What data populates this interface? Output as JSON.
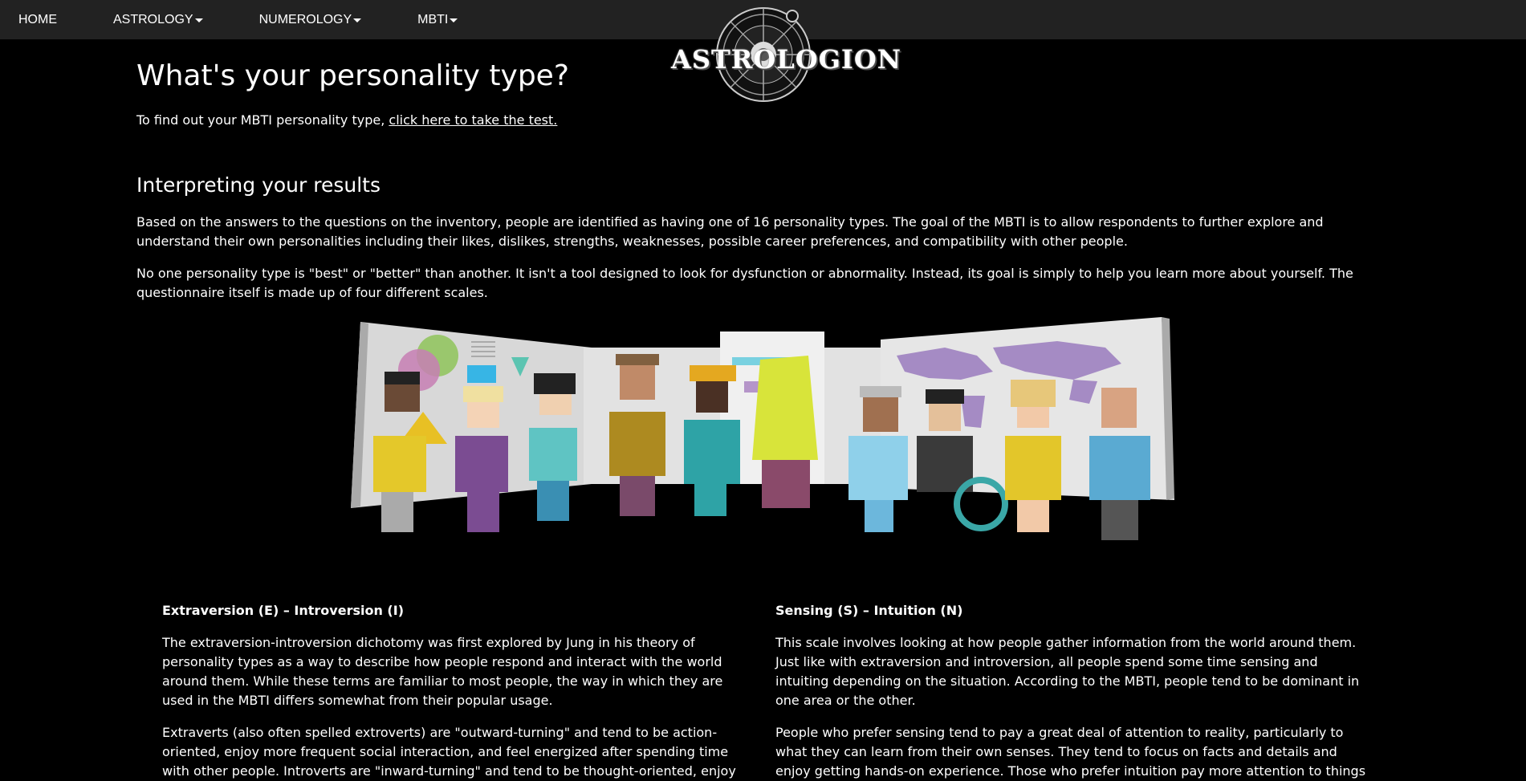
{
  "nav": {
    "home": "HOME",
    "astrology": "ASTROLOGY",
    "numerology": "NUMEROLOGY",
    "mbti": "MBTI"
  },
  "logo": {
    "text": "ASTROLOGION"
  },
  "page": {
    "title": "What's your personality type?",
    "intro_prefix": "To find out your MBTI personality type, ",
    "intro_link": "click here to take the test.",
    "section_heading": "Interpreting your results",
    "para1": "Based on the answers to the questions on the inventory, people are identified as having one of 16 personality types. The goal of the MBTI is to allow respondents to further explore and understand their own personalities including their likes, dislikes, strengths, weaknesses, possible career preferences, and compatibility with other people.",
    "para2": "No one personality type is \"best\" or \"better\" than another. It isn't a tool designed to look for dysfunction or abnormality. Instead, its goal is simply to help you learn more about yourself. The questionnaire itself is made up of four different scales."
  },
  "columns": {
    "left": {
      "heading": "Extraversion (E) – Introversion (I)",
      "p1": "The extraversion-introversion dichotomy was first explored by Jung in his theory of personality types as a way to describe how people respond and interact with the world around them. While these terms are familiar to most people, the way in which they are used in the MBTI differs somewhat from their popular usage.",
      "p2": "Extraverts (also often spelled extroverts) are \"outward-turning\" and tend to be action-oriented, enjoy more frequent social interaction, and feel energized after spending time with other people. Introverts are \"inward-turning\" and tend to be thought-oriented, enjoy deep"
    },
    "right": {
      "heading": "Sensing (S) – Intuition (N)",
      "p1": "This scale involves looking at how people gather information from the world around them. Just like with extraversion and introversion, all people spend some time sensing and intuiting depending on the situation. According to the MBTI, people tend to be dominant in one area or the other.",
      "p2": "People who prefer sensing tend to pay a great deal of attention to reality, particularly to what they can learn from their own senses. They tend to focus on facts and details and enjoy getting hands-on experience. Those who prefer intuition pay more attention to things like"
    }
  },
  "colors": {
    "navbar": "#222222",
    "background": "#000000",
    "text": "#ffffff"
  }
}
